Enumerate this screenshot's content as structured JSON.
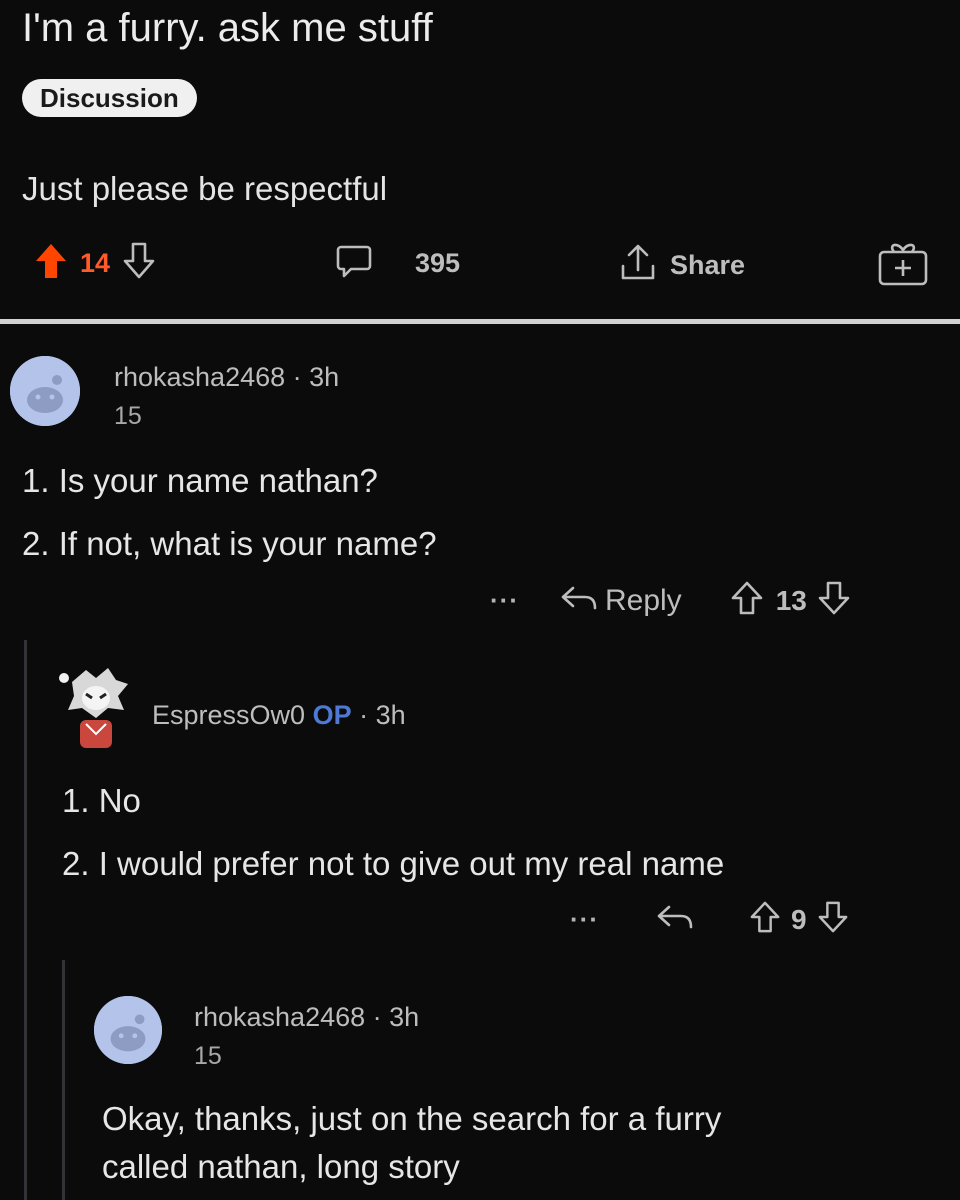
{
  "post": {
    "title": "I'm a furry. ask me stuff",
    "flair": "Discussion",
    "body": "Just please be respectful",
    "upvotes": "14",
    "comment_count": "395",
    "share_label": "Share"
  },
  "comments": [
    {
      "username": "rhokasha2468",
      "meta": "· 3h",
      "user_flair": "15",
      "lines": [
        "1. Is your name nathan?",
        "2. If not, what is your name?"
      ],
      "more": "···",
      "reply_label": "Reply",
      "votes": "13"
    },
    {
      "username": "EspressOw0",
      "op_badge": "OP",
      "meta": "· 3h",
      "lines": [
        "1. No",
        "2. I would prefer not to give out my real name"
      ],
      "more": "···",
      "votes": "9"
    },
    {
      "username": "rhokasha2468",
      "meta": "· 3h",
      "user_flair": "15",
      "lines": [
        "Okay, thanks, just on the search for a furry",
        "called nathan, long story"
      ]
    }
  ],
  "colors": {
    "upvote_active": "#ff4500",
    "op_badge": "#4e7ad6",
    "background": "#0b0b0c"
  }
}
